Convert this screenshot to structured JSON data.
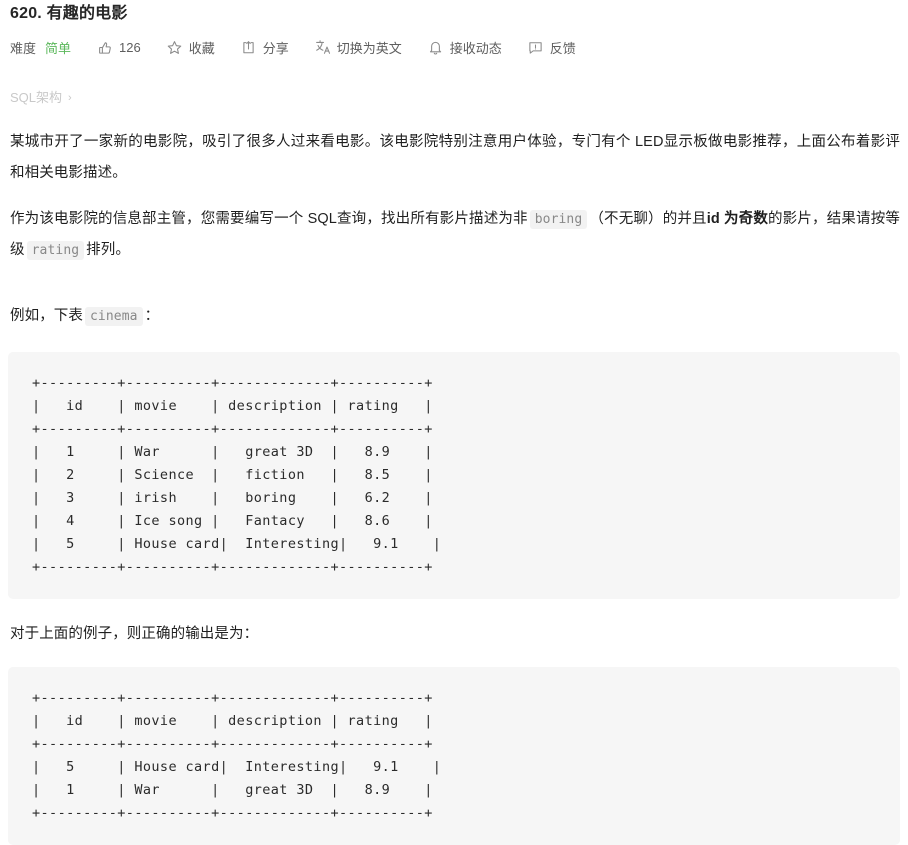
{
  "problem": {
    "number": "620.",
    "title": "有趣的电影",
    "full_title": "620. 有趣的电影"
  },
  "toolbar": {
    "difficulty_label": "难度",
    "difficulty_value": "简单",
    "difficulty_color": "#5cb85c",
    "like_icon": "thumbs-up-icon",
    "like_count": "126",
    "favorite_icon": "star-icon",
    "favorite_label": "收藏",
    "share_icon": "share-icon",
    "share_label": "分享",
    "translate_icon": "translate-icon",
    "translate_label": "切换为英文",
    "subscribe_icon": "bell-icon",
    "subscribe_label": "接收动态",
    "feedback_icon": "feedback-icon",
    "feedback_label": "反馈"
  },
  "schema": {
    "label": "SQL架构",
    "chevron": "›"
  },
  "description": {
    "p1": "某城市开了一家新的电影院，吸引了很多人过来看电影。该电影院特别注意用户体验，专门有个 LED显示板做电影推荐，上面公布着影评和相关电影描述。",
    "p2_part1": "作为该电影院的信息部主管，您需要编写一个 SQL查询，找出所有影片描述为非",
    "p2_code1": "boring",
    "p2_part2": "（不无聊）的并且",
    "p2_strong": "id 为奇数",
    "p2_part3": "的影片，结果请按等级",
    "p2_code2": "rating",
    "p2_part4": "排列。",
    "p3_part1": "例如，下表",
    "p3_code": "cinema",
    "p3_part2": "：",
    "p4": "对于上面的例子，则正确的输出是为："
  },
  "table_example": {
    "separator": "+---------+----------+-------------+----------+",
    "header": "|   id    | movie    | description | rating   |",
    "rows": [
      "|   1     | War      |   great 3D  |   8.9    |",
      "|   2     | Science  |   fiction   |   8.5    |",
      "|   3     | irish    |   boring    |   6.2    |",
      "|   4     | Ice song |   Fantacy   |   8.6    |",
      "|   5     | House card|  Interesting|   9.1    |"
    ],
    "full_text": "+---------+----------+-------------+----------+\n|   id    | movie    | description | rating   |\n+---------+----------+-------------+----------+\n|   1     | War      |   great 3D  |   8.9    |\n|   2     | Science  |   fiction   |   8.5    |\n|   3     | irish    |   boring    |   6.2    |\n|   4     | Ice song |   Fantacy   |   8.6    |\n|   5     | House card|  Interesting|   9.1    |\n+---------+----------+-------------+----------+"
  },
  "table_output": {
    "separator": "+---------+----------+-------------+----------+",
    "header": "|   id    | movie    | description | rating   |",
    "rows": [
      "|   5     | House card|  Interesting|   9.1    |",
      "|   1     | War      |   great 3D  |   8.9    |"
    ],
    "full_text": "+---------+----------+-------------+----------+\n|   id    | movie    | description | rating   |\n+---------+----------+-------------+----------+\n|   5     | House card|  Interesting|   9.1    |\n|   1     | War      |   great 3D  |   8.9    |\n+---------+----------+-------------+----------+"
  },
  "chart_data": {
    "type": "table",
    "title": "cinema",
    "columns": [
      "id",
      "movie",
      "description",
      "rating"
    ],
    "rows": [
      [
        "1",
        "War",
        "great 3D",
        "8.9"
      ],
      [
        "2",
        "Science",
        "fiction",
        "8.5"
      ],
      [
        "3",
        "irish",
        "boring",
        "6.2"
      ],
      [
        "4",
        "Ice song",
        "Fantacy",
        "8.6"
      ],
      [
        "5",
        "House card",
        "Interesting",
        "9.1"
      ]
    ],
    "expected_output_columns": [
      "id",
      "movie",
      "description",
      "rating"
    ],
    "expected_output_rows": [
      [
        "5",
        "House card",
        "Interesting",
        "9.1"
      ],
      [
        "1",
        "War",
        "great 3D",
        "8.9"
      ]
    ]
  }
}
